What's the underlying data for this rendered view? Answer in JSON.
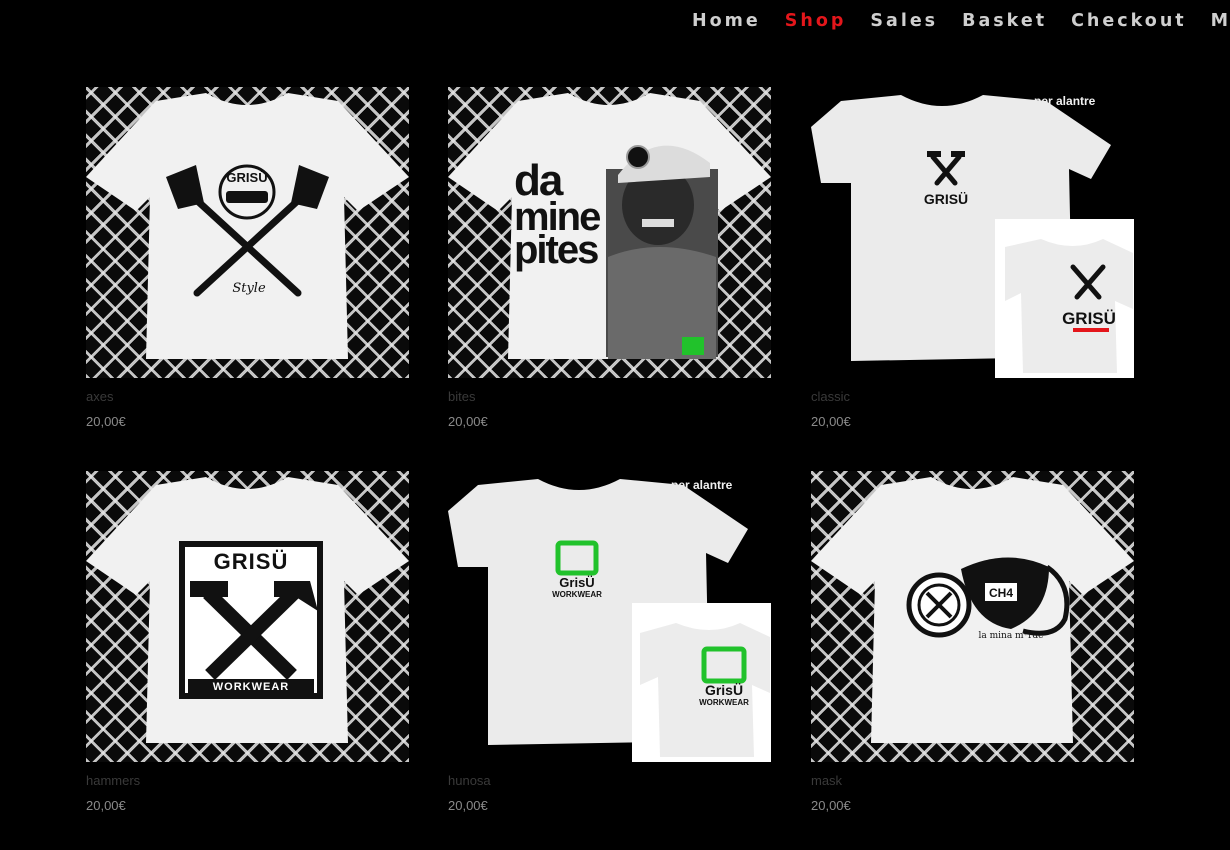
{
  "nav": {
    "items": [
      "Home",
      "Shop",
      "Sales",
      "Basket",
      "Checkout",
      "My"
    ],
    "active": "Shop",
    "active_color": "#e4161b"
  },
  "products": [
    {
      "name": "axes",
      "price": "20,00€",
      "shirt_text": [
        "GRISÜ",
        "Style"
      ]
    },
    {
      "name": "bites",
      "price": "20,00€",
      "shirt_text": [
        "da",
        "mine",
        "pites"
      ]
    },
    {
      "name": "classic",
      "price": "20,00€",
      "shirt_text": [
        "per alantre",
        "GRISÜ",
        "GRISÜ"
      ]
    },
    {
      "name": "hammers",
      "price": "20,00€",
      "shirt_text": [
        "GRISÜ",
        "WORKWEAR"
      ]
    },
    {
      "name": "hunosa",
      "price": "20,00€",
      "shirt_text": [
        "per alantre",
        "GrisÜ",
        "WORKWEAR",
        "GrisÜ",
        "WORKWEAR"
      ]
    },
    {
      "name": "mask",
      "price": "20,00€",
      "shirt_text": [
        "CH4",
        "la mina m*rde"
      ]
    }
  ],
  "colors": {
    "logo_green": "#21c22b",
    "accent_red": "#e4161b"
  }
}
